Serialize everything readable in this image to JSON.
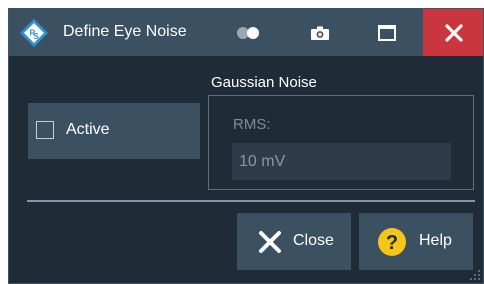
{
  "window": {
    "title": "Define Eye Noise",
    "controls": {
      "transparency_icon": "toggle-transparency-icon",
      "screenshot_icon": "camera-icon",
      "maximize_icon": "maximize-icon",
      "close_icon": "close-icon"
    }
  },
  "active": {
    "label": "Active",
    "checked": false
  },
  "gaussian_noise": {
    "title": "Gaussian Noise",
    "rms_label": "RMS:",
    "rms_value": "10 mV"
  },
  "buttons": {
    "close_label": "Close",
    "help_label": "Help",
    "help_symbol": "?"
  },
  "colors": {
    "background": "#1f2c37",
    "panel": "#3b5061",
    "close_accent": "#c9363e",
    "help_accent": "#f5c518"
  }
}
